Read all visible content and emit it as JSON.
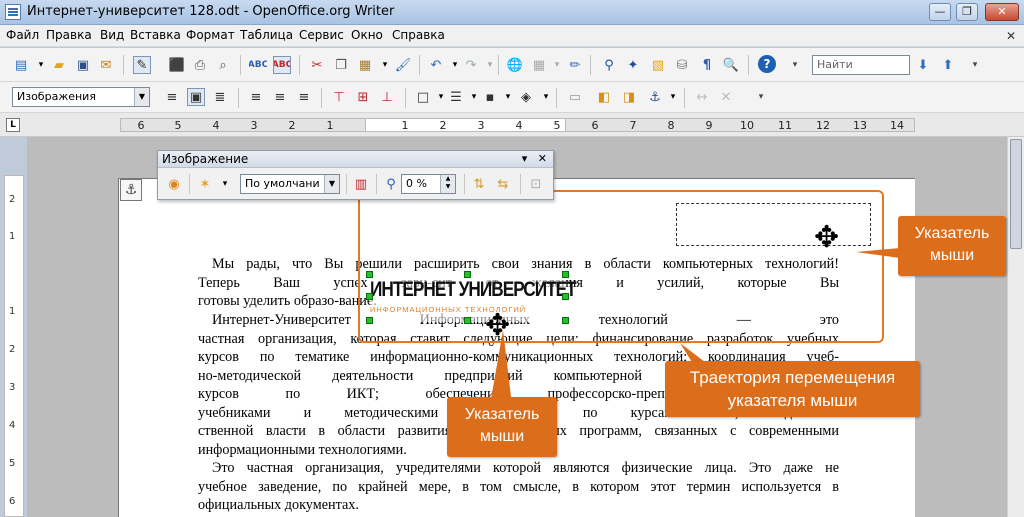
{
  "window": {
    "title": "Интернет-университет 128.odt - OpenOffice.org Writer",
    "minimize": "—",
    "maximize": "❐",
    "close": "✕"
  },
  "menu": {
    "items": [
      "Файл",
      "Правка",
      "Вид",
      "Вставка",
      "Формат",
      "Таблица",
      "Сервис",
      "Окно",
      "Справка"
    ],
    "close_doc": "✕"
  },
  "toolbar": {
    "search_placeholder": "Найти",
    "style_value": "Изображения"
  },
  "ruler": {
    "ticks": [
      "6",
      "5",
      "4",
      "3",
      "2",
      "1",
      "1",
      "2",
      "3",
      "4",
      "5",
      "6",
      "7",
      "8",
      "9",
      "10",
      "11",
      "12",
      "13",
      "14"
    ],
    "vticks": [
      "2",
      "1",
      "1",
      "2",
      "3",
      "4",
      "5",
      "6",
      "7"
    ],
    "corner": "L"
  },
  "image_panel": {
    "title": "Изображение",
    "mode_value": "По умолчани",
    "transparency_value": "0 %"
  },
  "document": {
    "paragraphs": [
      {
        "lines": [
          "Мы рады, что Вы решили расширить свои знания в области компьютерных технологий!",
          "Теперь Ваш успех зави-сит от желания и усилий, которые Вы",
          "готовы уделить образо-вание."
        ]
      },
      {
        "lines": [
          "Интернет-Университет Информационных технологий — это",
          "частная организация, которая ставит следующие цели: финансирование разработок учебных",
          "курсов по тематике информационно-коммуникационных технологий; координация учеб-",
          "но-методической деятельности предприятий компьютерной индустрии; подготовка",
          "курсов по ИКТ; обеспечение профессорско-преподавательских кадров",
          "учебниками и методическими материалами по курсам ИКТ; содействие",
          "ственной власти в области развития образовательных программ, связанных с современными",
          "информационными технологиями."
        ]
      },
      {
        "lines": [
          "Это частная организация, учредителями которой являются физические лица. Это даже не",
          "учебное заведение, по крайней мере, в том смысле, в котором этот термин используется в",
          "официальных документах."
        ]
      }
    ],
    "logo_main": "ИНТЕРНЕТ УНИВЕРСИТЕТ",
    "logo_sub": "ИНФОРМАЦИОННЫХ ТЕХНОЛОГИЙ"
  },
  "callouts": {
    "pointer_right": "Указатель мыши",
    "pointer_left": "Указатель мыши",
    "trajectory": "Траектория перемещения указателя мыши"
  },
  "colors": {
    "callout_bg": "#dc6d1b",
    "trajectory_border": "#e07a24",
    "handle_green": "#25c12b"
  }
}
